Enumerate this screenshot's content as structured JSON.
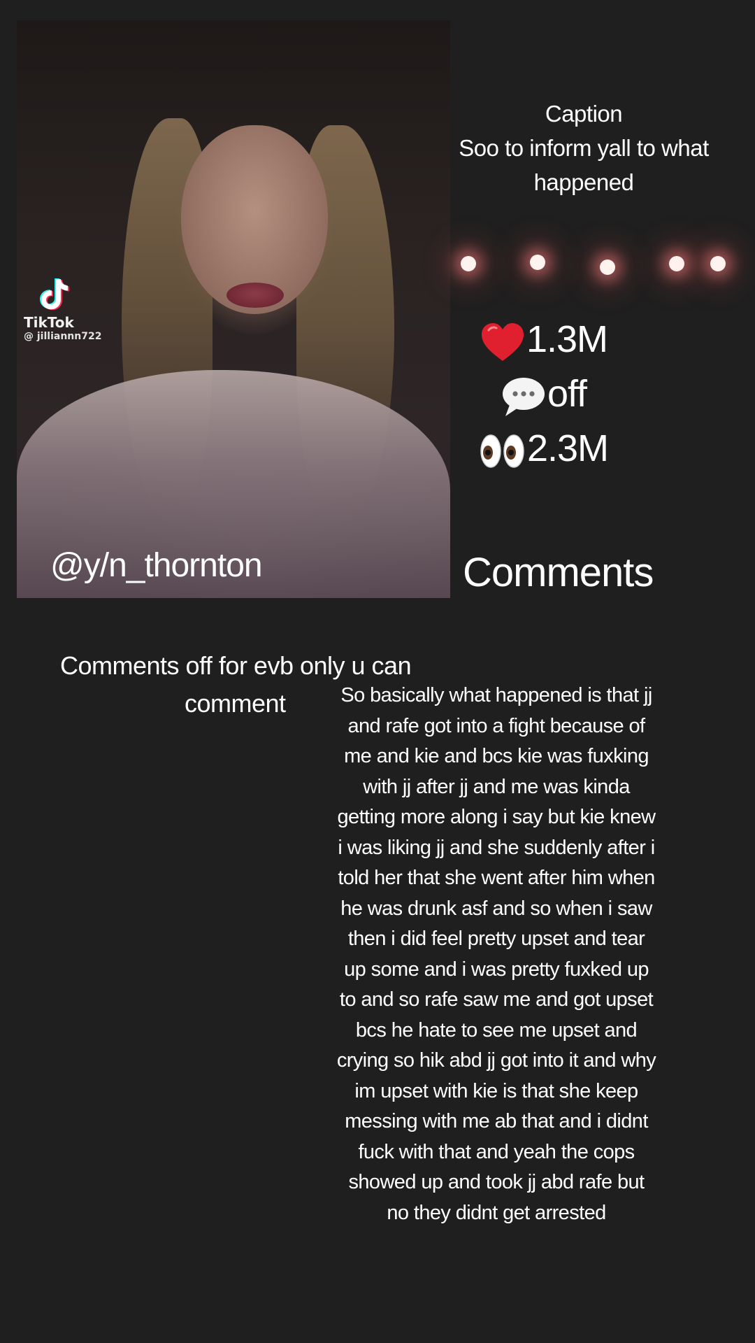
{
  "video": {
    "watermark_brand": "TikTok",
    "watermark_user": "@ jilliannn722",
    "username": "@y/n_thornton"
  },
  "caption": {
    "heading": "Caption",
    "text": "Soo to inform yall to what happened"
  },
  "stats": {
    "likes_icon": "heart-icon",
    "likes": "1.3M",
    "comments_icon": "speech-bubble-icon",
    "comments": "off",
    "views_icon": "eyes-icon",
    "views": "2.3M"
  },
  "comments": {
    "heading": "Comments",
    "notice_line1": "Comments off for evb  only u can",
    "notice_line2": "comment"
  },
  "story": {
    "text": "So basically what happened is that jj and rafe got into a fight because of me and kie and bcs kie was fuxking with jj after jj and me was kinda getting more along i say but kie knew i was liking jj and she suddenly after i told her that she went after him when he was drunk asf and so when i saw then i did feel pretty upset and tear up some and i was pretty fuxked up to and so rafe saw me and got upset bcs he hate to see me upset and crying so hik abd jj got into it and why im upset with kie is that she keep messing with me ab that and i didnt fuck with that and yeah the cops showed up and took jj abd rafe but no they didnt get arrested"
  },
  "colors": {
    "background": "#1f1f1f",
    "text": "#ffffff",
    "heart": "#e0202e",
    "light_glow": "#ff8282"
  }
}
